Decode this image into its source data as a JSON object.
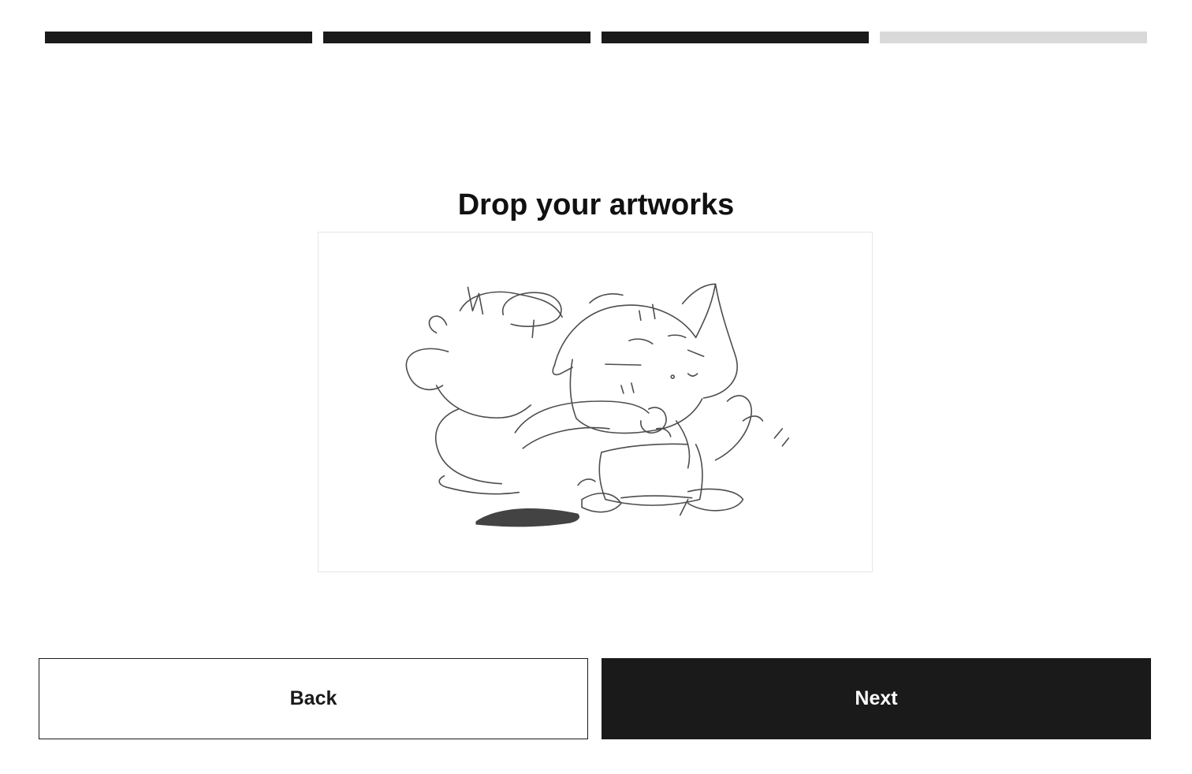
{
  "progress": {
    "total_steps": 4,
    "completed_steps": 3,
    "active_color": "#1a1a1a",
    "inactive_color": "#d9d9d9"
  },
  "main": {
    "title": "Drop your artworks",
    "dropzone_image": "sketch-artwork-cat-and-monkey"
  },
  "actions": {
    "back_label": "Back",
    "next_label": "Next"
  }
}
